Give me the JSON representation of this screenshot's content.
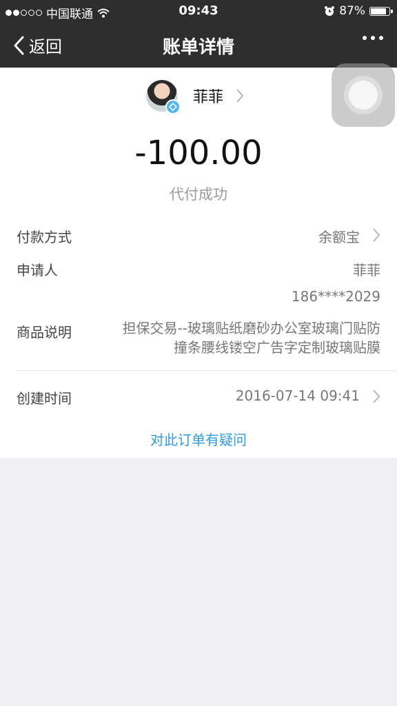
{
  "status_bar": {
    "carrier": "中国联通",
    "time": "09:43",
    "battery": "87%",
    "battery_level": 0.87
  },
  "nav": {
    "back_label": "返回",
    "title": "账单详情"
  },
  "payee": {
    "name": "菲菲"
  },
  "amount": "-100.00",
  "status": "代付成功",
  "details": {
    "payment_method": {
      "label": "付款方式",
      "value": "余额宝"
    },
    "applicant": {
      "label": "申请人",
      "name": "菲菲",
      "phone": "186****2029"
    },
    "product": {
      "label": "商品说明",
      "line1": "担保交易--玻璃贴纸磨砂办公室玻璃门贴防",
      "line2": "撞条腰线镂空广告字定制玻璃贴膜"
    },
    "created": {
      "label": "创建时间",
      "value": "2016-07-14 09:41"
    }
  },
  "question_link": "对此订单有疑问",
  "colors": {
    "nav_bg": "#2e2e2e",
    "link": "#2f9be0",
    "page_bg": "#efeff4"
  }
}
